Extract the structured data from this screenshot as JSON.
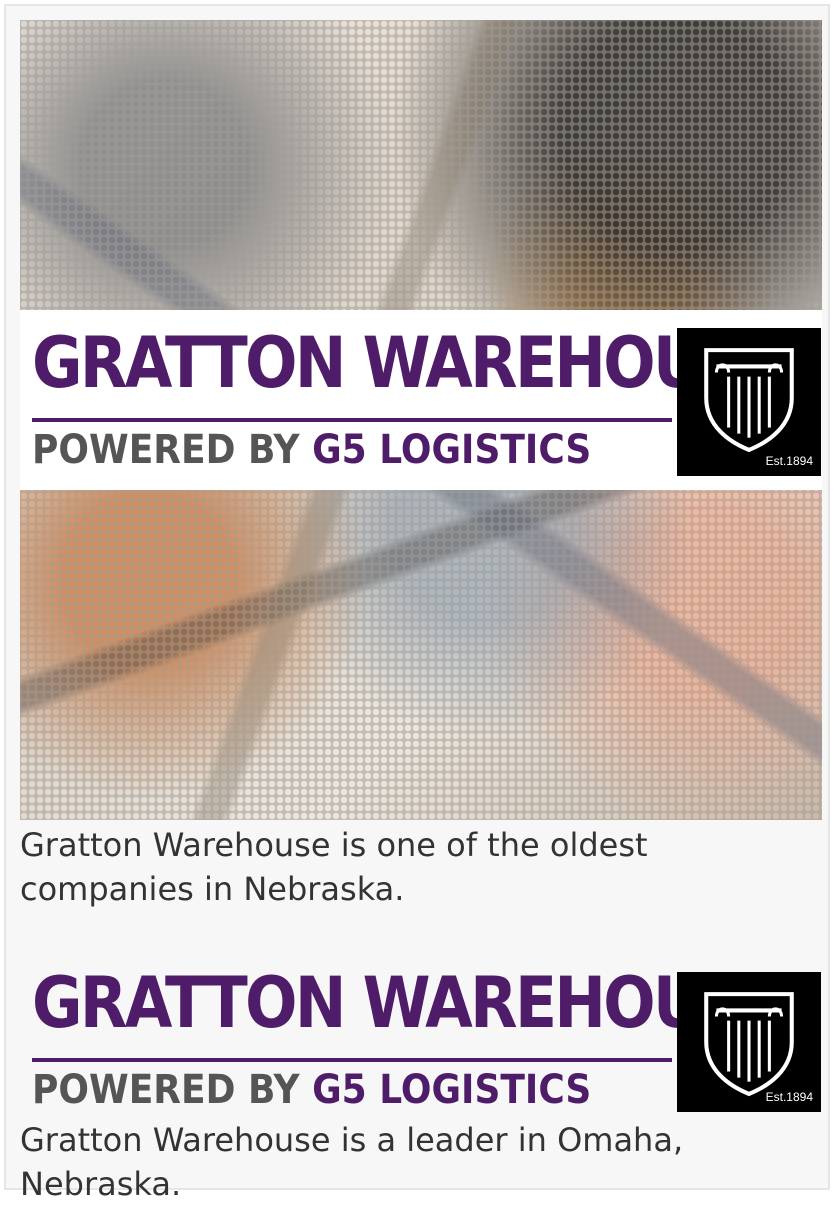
{
  "banner": {
    "title": "GRATTON WAREHOUSE",
    "subtitle_prefix": "POWERED BY",
    "subtitle_accent": "G5 LOGISTICS",
    "emblem_text": "Est.1894"
  },
  "captions": [
    "Gratton Warehouse is one of the oldest companies in Nebraska.",
    "Gratton Warehouse is a leader in Omaha, Nebraska."
  ],
  "colors": {
    "brand_purple": "#4f1c69",
    "subtitle_gray": "#555555",
    "caption_text": "#333333"
  }
}
